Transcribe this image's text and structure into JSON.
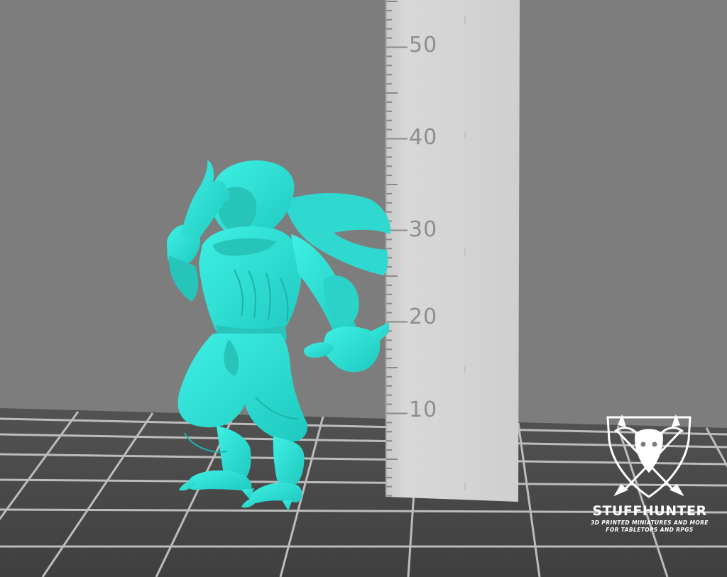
{
  "scene": {
    "background_color": "#7d7d7d",
    "floor_color": "#4c4c4c",
    "grid_line_color": "#bdbdbd",
    "model_color": "#33e0d6"
  },
  "ruler": {
    "color": "#d4d4d4",
    "labels": [
      "50",
      "40",
      "30",
      "20",
      "10"
    ]
  },
  "watermark": {
    "logo_icon": "bull-skull-arrows-shield-icon",
    "name": "STUFFHUNTER",
    "tagline_1": "3D PRINTED MINIATURES AND MORE",
    "tagline_2": "FOR TABLETOPS AND RPGS"
  }
}
